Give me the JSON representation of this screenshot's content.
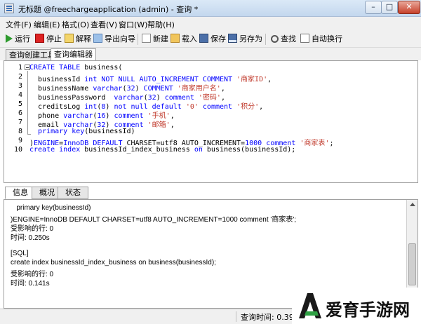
{
  "window": {
    "title": "无标题 @freechargeapplication (admin) - 查询 *",
    "minimize_label": "–",
    "maximize_label": "□",
    "close_label": "✕"
  },
  "menu": [
    "文件(F)",
    "编辑(E)",
    "格式(O)",
    "查看(V)",
    "窗口(W)",
    "帮助(H)"
  ],
  "toolbar": {
    "run": "运行",
    "stop": "停止",
    "explain": "解释",
    "export_wizard": "导出向导",
    "new": "新建",
    "load": "载入",
    "save": "保存",
    "save_as": "另存为",
    "find": "查找",
    "word_wrap": "自动换行"
  },
  "top_tabs": [
    "查询创建工具",
    "查询编辑器"
  ],
  "editor": {
    "line_numbers": [
      "1",
      "2",
      "3",
      "4",
      "5",
      "6",
      "7",
      "8",
      "9",
      "10"
    ]
  },
  "bottom_tabs": [
    "信息",
    "概况",
    "状态"
  ],
  "info_lines": [
    "   primary key(businessId)",
    ")ENGINE=InnoDB DEFAULT CHARSET=utf8 AUTO_INCREMENT=1000 comment '商家表';",
    "受影响的行: 0",
    "时间: 0.250s",
    "",
    "[SQL]",
    "create index businessId_index_business on business(businessId);",
    "受影响的行: 0",
    "时间: 0.141s"
  ],
  "status": {
    "query_time": "查询时间: 0.39"
  },
  "watermark": {
    "text": "爱育手游网"
  },
  "colors": {
    "keyword": "#0000ff",
    "string": "#c0392b",
    "titlebar": "#c3d7ee"
  }
}
